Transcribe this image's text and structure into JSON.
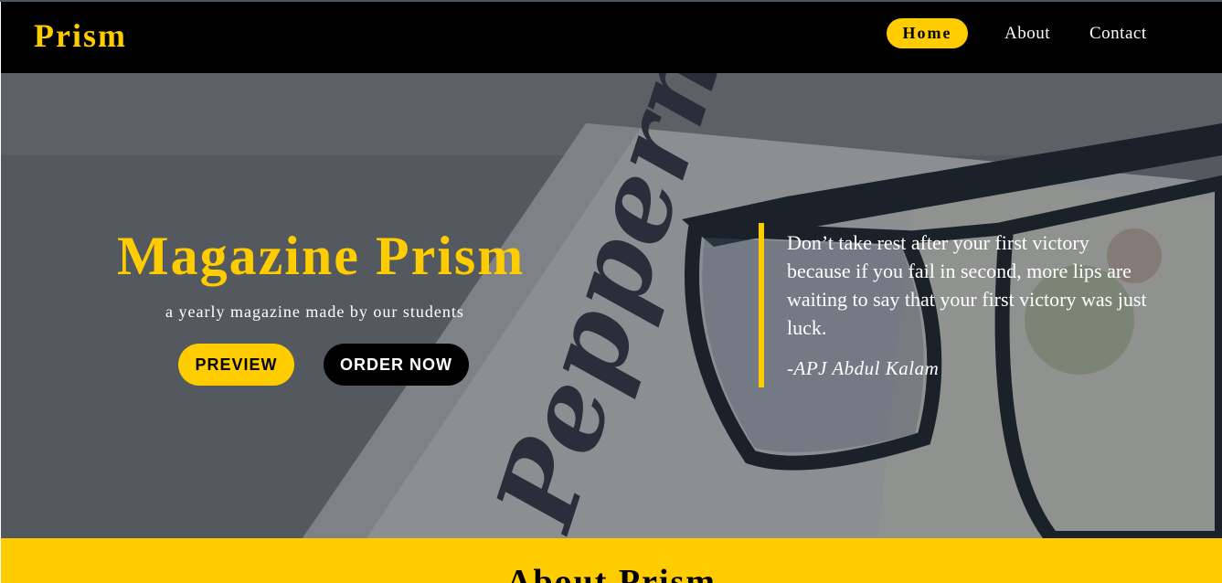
{
  "nav": {
    "brand": "Prism",
    "links": [
      {
        "label": "Home",
        "active": true
      },
      {
        "label": "About",
        "active": false
      },
      {
        "label": "Contact",
        "active": false
      }
    ]
  },
  "hero": {
    "title": "Magazine Prism",
    "subtitle": "a yearly magazine made by our students",
    "buttons": {
      "preview": "PREVIEW",
      "order": "ORDER NOW"
    },
    "quote": {
      "text": "Don’t take rest after your first victory because if you fail in second, more lips are waiting to say that your first victory was just luck.",
      "author": "-APJ Abdul Kalam"
    },
    "background_magazine_script": "Peppermint"
  },
  "about": {
    "heading": "About Prism"
  },
  "colors": {
    "accent": "#ffcc00",
    "navbar": "#000000",
    "text_light": "#ffffff"
  }
}
